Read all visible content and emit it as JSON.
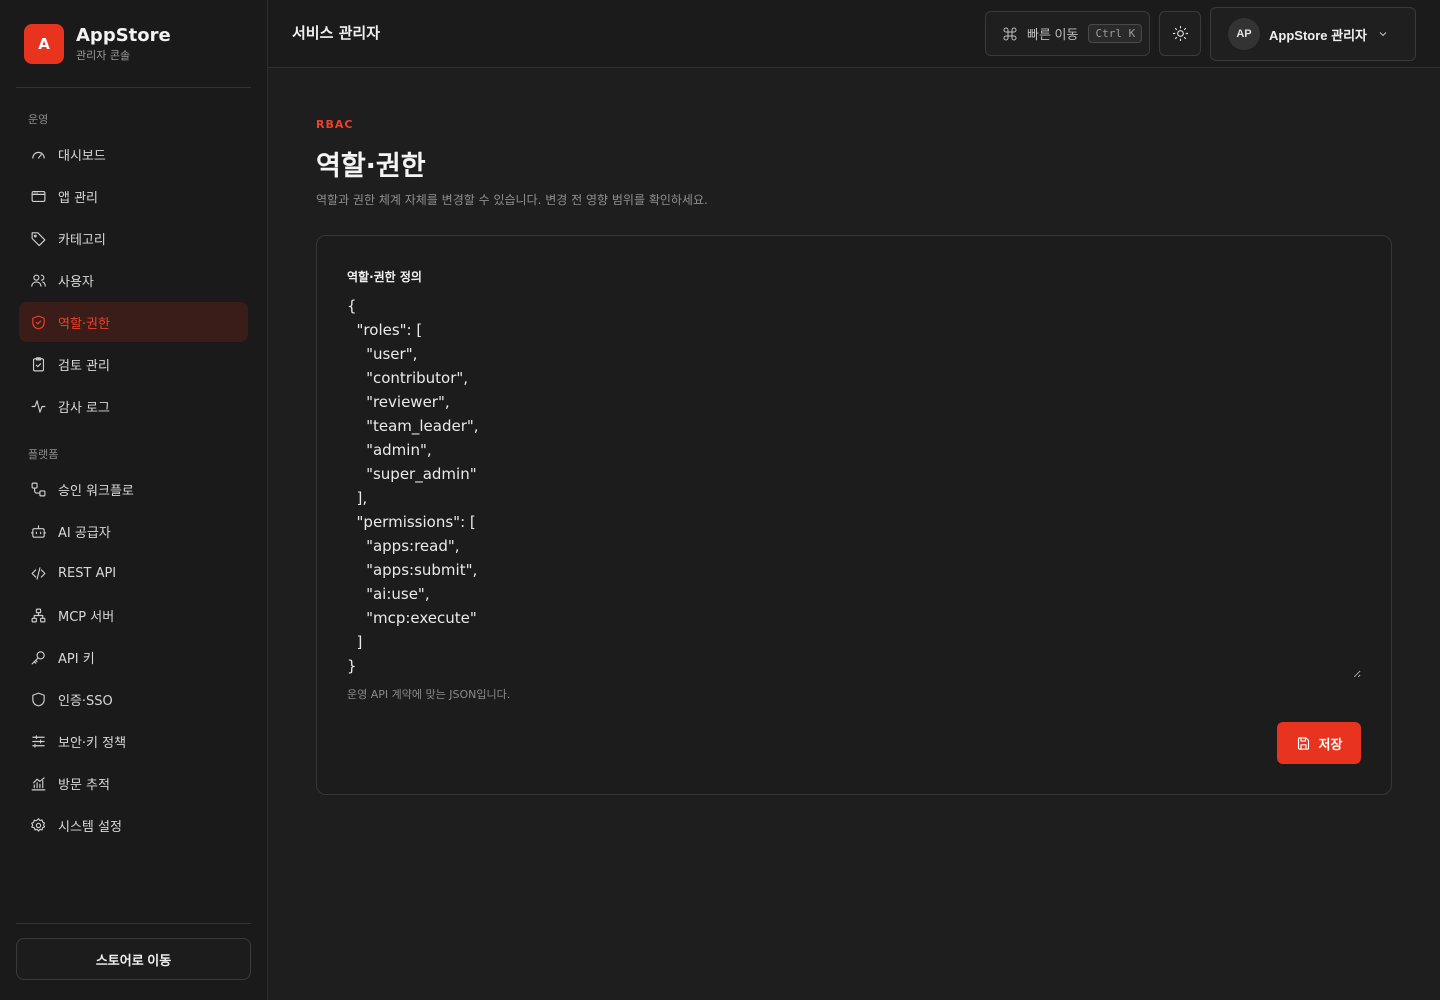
{
  "brand": {
    "logo_letter": "A",
    "name": "AppStore",
    "subtitle": "관리자 콘솔"
  },
  "sidebar": {
    "sections": [
      {
        "label": "운영",
        "items": [
          {
            "label": "대시보드",
            "icon": "dashboard-icon"
          },
          {
            "label": "앱 관리",
            "icon": "app-window-icon"
          },
          {
            "label": "카테고리",
            "icon": "tag-icon"
          },
          {
            "label": "사용자",
            "icon": "users-icon"
          },
          {
            "label": "역할·권한",
            "icon": "shield-check-icon",
            "active": true
          },
          {
            "label": "검토 관리",
            "icon": "clipboard-check-icon"
          },
          {
            "label": "감사 로그",
            "icon": "activity-icon"
          }
        ]
      },
      {
        "label": "플랫폼",
        "items": [
          {
            "label": "승인 워크플로",
            "icon": "workflow-icon"
          },
          {
            "label": "AI 공급자",
            "icon": "bot-icon"
          },
          {
            "label": "REST API",
            "icon": "code-icon"
          },
          {
            "label": "MCP 서버",
            "icon": "network-icon"
          },
          {
            "label": "API 키",
            "icon": "key-icon"
          },
          {
            "label": "인증·SSO",
            "icon": "shield-icon"
          },
          {
            "label": "보안·키 정책",
            "icon": "sliders-icon"
          },
          {
            "label": "방문 추적",
            "icon": "chart-icon"
          },
          {
            "label": "시스템 설정",
            "icon": "gear-icon"
          }
        ]
      }
    ],
    "store_button": "스토어로 이동"
  },
  "topbar": {
    "title": "서비스 관리자",
    "quick_nav": "빠른 이동",
    "quick_nav_kbd": "Ctrl K",
    "user_initials": "AP",
    "user_name": "AppStore 관리자"
  },
  "page": {
    "eyebrow": "RBAC",
    "title": "역할·권한",
    "description": "역할과 권한 체계 자체를 변경할 수 있습니다. 변경 전 영향 범위를 확인하세요."
  },
  "editor": {
    "label": "역할·권한 정의",
    "value": "{\n  \"roles\": [\n    \"user\",\n    \"contributor\",\n    \"reviewer\",\n    \"team_leader\",\n    \"admin\",\n    \"super_admin\"\n  ],\n  \"permissions\": [\n    \"apps:read\",\n    \"apps:submit\",\n    \"ai:use\",\n    \"mcp:execute\"\n  ]\n}",
    "help": "운영 API 계약에 맞는 JSON입니다.",
    "save_label": "저장"
  },
  "colors": {
    "accent": "#e8341f",
    "background": "#1c1c1c"
  }
}
